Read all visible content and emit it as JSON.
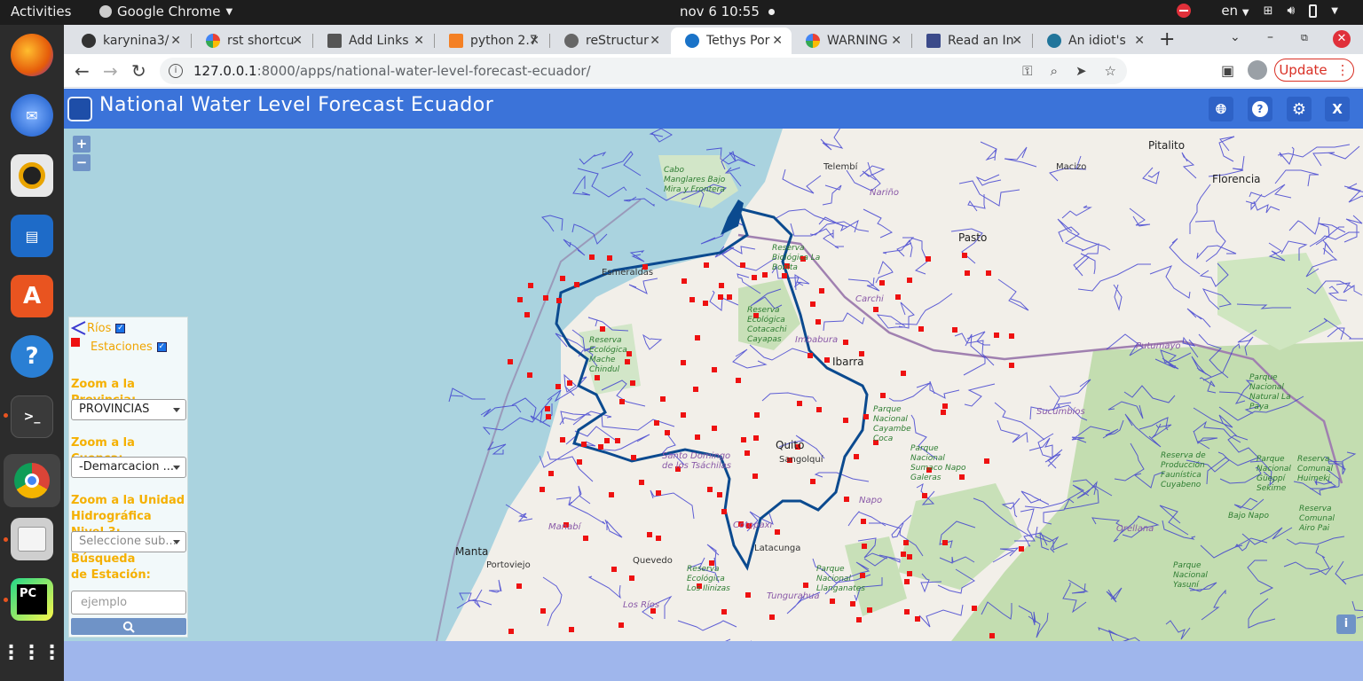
{
  "topbar": {
    "activities": "Activities",
    "app_name": "Google Chrome",
    "clock": "nov 6  10:55",
    "lang": "en"
  },
  "dock": {
    "items": [
      "firefox-icon",
      "thunderbird-icon",
      "rhythmbox-icon",
      "libreoffice-writer-icon",
      "ubuntu-software-icon",
      "help-icon",
      "terminal-icon",
      "chrome-icon",
      "files-icon",
      "pycharm-icon",
      "app-grid-icon"
    ]
  },
  "browser": {
    "tabs": [
      {
        "label": "karynina3/",
        "favicon": "github-icon"
      },
      {
        "label": "rst shortcu",
        "favicon": "google-icon"
      },
      {
        "label": "Add Links",
        "favicon": "doc-icon"
      },
      {
        "label": "python 2.7",
        "favicon": "stackoverflow-icon"
      },
      {
        "label": "reStructur",
        "favicon": "page-icon"
      },
      {
        "label": "Tethys Por",
        "favicon": "tethys-icon"
      },
      {
        "label": "WARNING",
        "favicon": "google-icon"
      },
      {
        "label": "Read an In",
        "favicon": "page-icon"
      },
      {
        "label": "An idiot's",
        "favicon": "wordpress-icon"
      }
    ],
    "url_host": "127.0.0.1",
    "url_path": ":8000/apps/national-water-level-forecast-ecuador/",
    "update_label": "Update"
  },
  "app": {
    "title": "National Water Level Forecast Ecuador",
    "header_buttons": {
      "close": "X"
    },
    "zoom_in": "+",
    "zoom_out": "−",
    "legend": {
      "rivers": "Ríos",
      "stations": "Estaciones"
    },
    "labels": {
      "province": "Zoom a la Provincia:",
      "basin": "Zoom a la Cuenca:",
      "unit": "Zoom a la Unidad Hidrográfica Nivel 3:",
      "station_search": "Búsqueda de Estación:"
    },
    "selects": {
      "province": "PROVINCIAS",
      "basin": "-Demarcacion ...",
      "unit_placeholder": "Seleccione sub..."
    },
    "search_placeholder": "ejemplo",
    "info_label": "i"
  },
  "map": {
    "places": [
      {
        "name": "Pitalito",
        "type": "city"
      },
      {
        "name": "Telembí",
        "type": "town"
      },
      {
        "name": "Macizo",
        "type": "town"
      },
      {
        "name": "Florencia",
        "type": "city"
      },
      {
        "name": "Nariño",
        "type": "region"
      },
      {
        "name": "Pasto",
        "type": "city"
      },
      {
        "name": "Cabo Manglares Bajo Mira y Frontera",
        "type": "park"
      },
      {
        "name": "Esmeraldas",
        "type": "city"
      },
      {
        "name": "Carchi",
        "type": "region"
      },
      {
        "name": "Putumayo",
        "type": "region"
      },
      {
        "name": "Imbabura",
        "type": "region"
      },
      {
        "name": "Ibarra",
        "type": "city"
      },
      {
        "name": "Quito",
        "type": "city"
      },
      {
        "name": "Sangolquí",
        "type": "town"
      },
      {
        "name": "Sucumbíos",
        "type": "region"
      },
      {
        "name": "Manabí",
        "type": "region"
      },
      {
        "name": "Santo Domingo de los Tsáchilas",
        "type": "region"
      },
      {
        "name": "Napo",
        "type": "region"
      },
      {
        "name": "Orellana",
        "type": "region"
      },
      {
        "name": "Manta",
        "type": "city"
      },
      {
        "name": "Portoviejo",
        "type": "city"
      },
      {
        "name": "Quevedo",
        "type": "city"
      },
      {
        "name": "Latacunga",
        "type": "city"
      },
      {
        "name": "Cotopaxi",
        "type": "region"
      },
      {
        "name": "Los Ríos",
        "type": "region"
      },
      {
        "name": "Tungurahua",
        "type": "region"
      },
      {
        "name": "Parque Nacional Natural La Paya",
        "type": "park"
      },
      {
        "name": "Parque Nacional Cayambe Coca",
        "type": "park"
      },
      {
        "name": "Parque Nacional Sumaco Napo Galeras",
        "type": "park"
      },
      {
        "name": "Reserva de Producción Faunística Cuyabeno",
        "type": "park"
      },
      {
        "name": "Parque Nacional Yasuní",
        "type": "park"
      },
      {
        "name": "Parque Nacional Llanganates",
        "type": "park"
      },
      {
        "name": "Reserva Ecológica Los Ilinizas",
        "type": "park"
      },
      {
        "name": "Reserva Ecológica Cotacachi Cayapas",
        "type": "park"
      },
      {
        "name": "Reserva Ecológica Mache Chindul",
        "type": "park"
      },
      {
        "name": "Parque Nacional Güeppí Sekime",
        "type": "park"
      },
      {
        "name": "Reserva Comunal Huimeki",
        "type": "park"
      },
      {
        "name": "Reserva Comunal Airo Pai",
        "type": "park"
      },
      {
        "name": "Bajo Napo",
        "type": "park"
      },
      {
        "name": "Reserva Biológica La Bonita",
        "type": "park"
      }
    ]
  },
  "colors": {
    "app_header": "#3b73d9",
    "ocean": "#aad3df",
    "land": "#f2efe9",
    "river": "#3a3ad0",
    "basin_outline": "#0b4a8f",
    "station": "#ee1111",
    "panel_label": "#f5b000"
  }
}
